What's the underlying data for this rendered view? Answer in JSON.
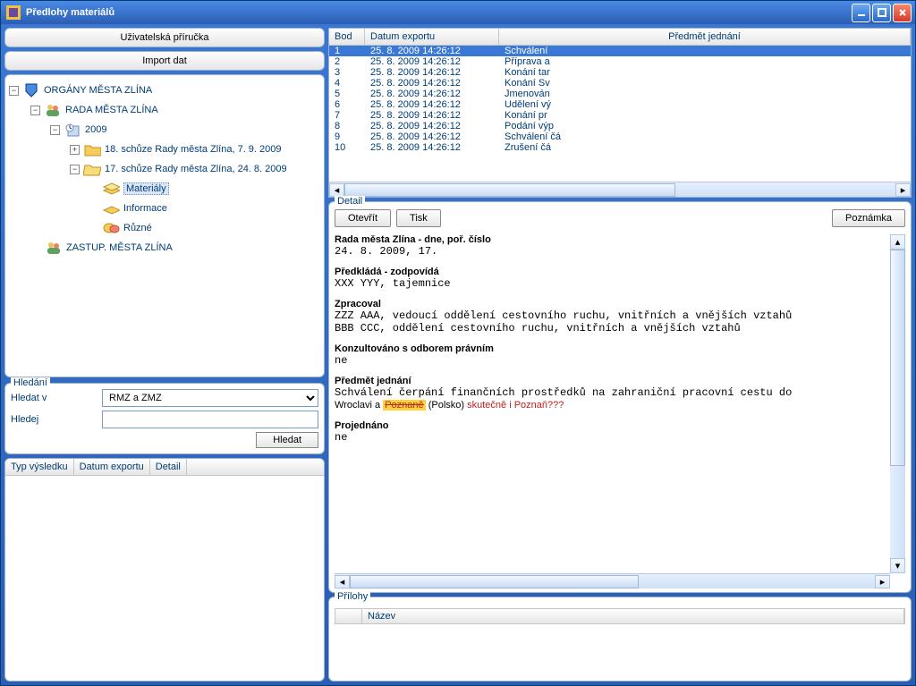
{
  "window": {
    "title": "Předlohy materiálů"
  },
  "left": {
    "manual_btn": "Uživatelská příručka",
    "import_btn": "Import dat",
    "tree": {
      "root": "ORGÁNY MĚSTA ZLÍNA",
      "rada": "RADA MĚSTA ZLÍNA",
      "year": "2009",
      "meeting18": "18. schůze Rady města Zlína, 7. 9. 2009",
      "meeting17": "17. schůze Rady města Zlína, 24. 8. 2009",
      "materialy": "Materiály",
      "informace": "Informace",
      "ruzne": "Různé",
      "zastup": "ZASTUP. MĚSTA ZLÍNA"
    },
    "search": {
      "legend": "Hledání",
      "label_in": "Hledat v",
      "label_find": "Hledej",
      "select_value": "RMZ a ZMZ",
      "find_value": "",
      "btn": "Hledat"
    },
    "results": {
      "col1": "Typ výsledku",
      "col2": "Datum exportu",
      "col3": "Detail"
    }
  },
  "grid": {
    "col1": "Bod",
    "col2": "Datum exportu",
    "col3": "Předmět jednání",
    "rows": [
      {
        "bod": "1",
        "date": "25. 8. 2009 14:26:12",
        "subj": "Schválení"
      },
      {
        "bod": "2",
        "date": "25. 8. 2009 14:26:12",
        "subj": "Příprava a"
      },
      {
        "bod": "3",
        "date": "25. 8. 2009 14:26:12",
        "subj": "Konání tar"
      },
      {
        "bod": "4",
        "date": "25. 8. 2009 14:26:12",
        "subj": "Konání Sv"
      },
      {
        "bod": "5",
        "date": "25. 8. 2009 14:26:12",
        "subj": "Jmenován"
      },
      {
        "bod": "6",
        "date": "25. 8. 2009 14:26:12",
        "subj": "Udělení vý"
      },
      {
        "bod": "7",
        "date": "25. 8. 2009 14:26:12",
        "subj": "Konání pr"
      },
      {
        "bod": "8",
        "date": "25. 8. 2009 14:26:12",
        "subj": "Podání výp"
      },
      {
        "bod": "9",
        "date": "25. 8. 2009 14:26:12",
        "subj": "Schválení čá"
      },
      {
        "bod": "10",
        "date": "25. 8. 2009 14:26:12",
        "subj": "Zrušení čá"
      }
    ]
  },
  "detail": {
    "legend": "Detail",
    "btn_open": "Otevřít",
    "btn_print": "Tisk",
    "btn_note": "Poznámka",
    "h1": "Rada města Zlína - dne, poř. číslo",
    "v1": "24.  8.  2009, 17.",
    "h2": "Předkládá - zodpovídá",
    "v2": "XXX YYY, tajemnice",
    "h3": "Zpracoval",
    "v3a": "ZZZ AAA, vedoucí oddělení cestovního ruchu, vnitřních a vnějších vztahů",
    "v3b": "BBB CCC, oddělení cestovního ruchu, vnitřních a vnějších vztahů",
    "h4": "Konzultováno s odborem právním",
    "v4": "ne",
    "h5": "Předmět jednání",
    "v5a": "Schválení čerpání finančních prostředků na zahraniční pracovní cestu do",
    "v5b": "Wroclavi a ",
    "v5struck": "Poznaně",
    "v5c": " (Polsko) ",
    "v5red": "skutečně i Poznaň???",
    "h6": "Projednáno",
    "v6": "ne"
  },
  "attach": {
    "legend": "Přílohy",
    "col1": "Název"
  }
}
